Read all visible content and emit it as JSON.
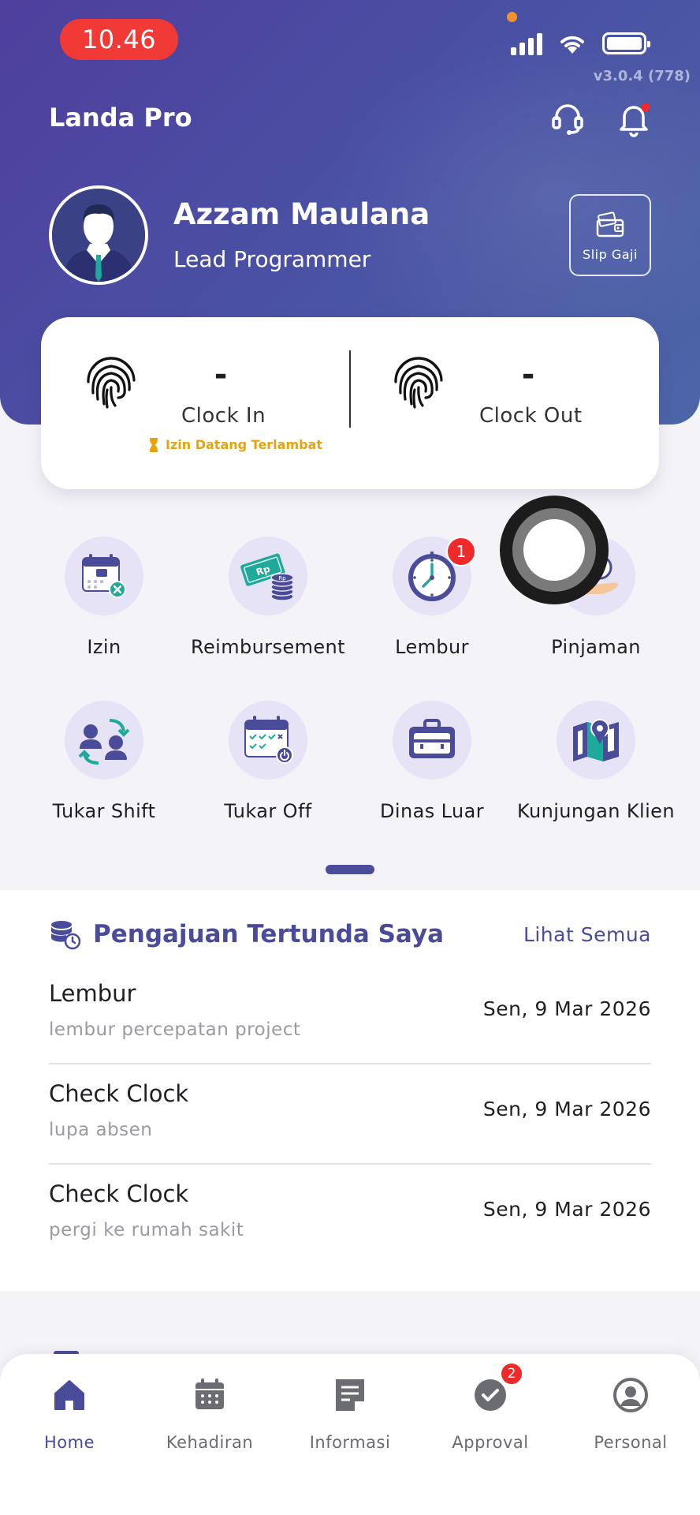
{
  "status_bar": {
    "time": "10.46",
    "version": "v3.0.4 (778)"
  },
  "header": {
    "title": "Landa Pro"
  },
  "profile": {
    "name": "Azzam Maulana",
    "role": "Lead Programmer",
    "slip_label": "Slip Gaji"
  },
  "clock": {
    "in_value": "-",
    "in_label": "Clock In",
    "out_value": "-",
    "out_label": "Clock Out",
    "late_note": "Izin Datang Terlambat"
  },
  "menu": [
    {
      "label": "Izin",
      "icon": "calendar-cancel-icon"
    },
    {
      "label": "Reimbursement",
      "icon": "money-coins-icon"
    },
    {
      "label": "Lembur",
      "icon": "clock-icon",
      "badge": "1"
    },
    {
      "label": "Pinjaman",
      "icon": "loan-hand-icon"
    },
    {
      "label": "Tukar Shift",
      "icon": "swap-users-icon"
    },
    {
      "label": "Tukar Off",
      "icon": "calendar-check-icon"
    },
    {
      "label": "Dinas Luar",
      "icon": "briefcase-icon"
    },
    {
      "label": "Kunjungan Klien",
      "icon": "map-pin-icon"
    }
  ],
  "pending": {
    "title": "Pengajuan Tertunda Saya",
    "see_all": "Lihat Semua",
    "items": [
      {
        "title": "Lembur",
        "subtitle": "lembur percepatan project",
        "date": "Sen, 9 Mar 2026"
      },
      {
        "title": "Check Clock",
        "subtitle": "lupa absen",
        "date": "Sen, 9 Mar 2026"
      },
      {
        "title": "Check Clock",
        "subtitle": "pergi ke rumah sakit",
        "date": "Sen, 9 Mar 2026"
      }
    ]
  },
  "bottom_nav": [
    {
      "label": "Home",
      "active": true
    },
    {
      "label": "Kehadiran"
    },
    {
      "label": "Informasi"
    },
    {
      "label": "Approval",
      "badge": "2"
    },
    {
      "label": "Personal"
    }
  ],
  "colors": {
    "primary": "#4a4c9a",
    "accent_teal": "#1fa99a",
    "badge_red": "#ee2a2a",
    "late_yellow": "#e8a20c"
  }
}
